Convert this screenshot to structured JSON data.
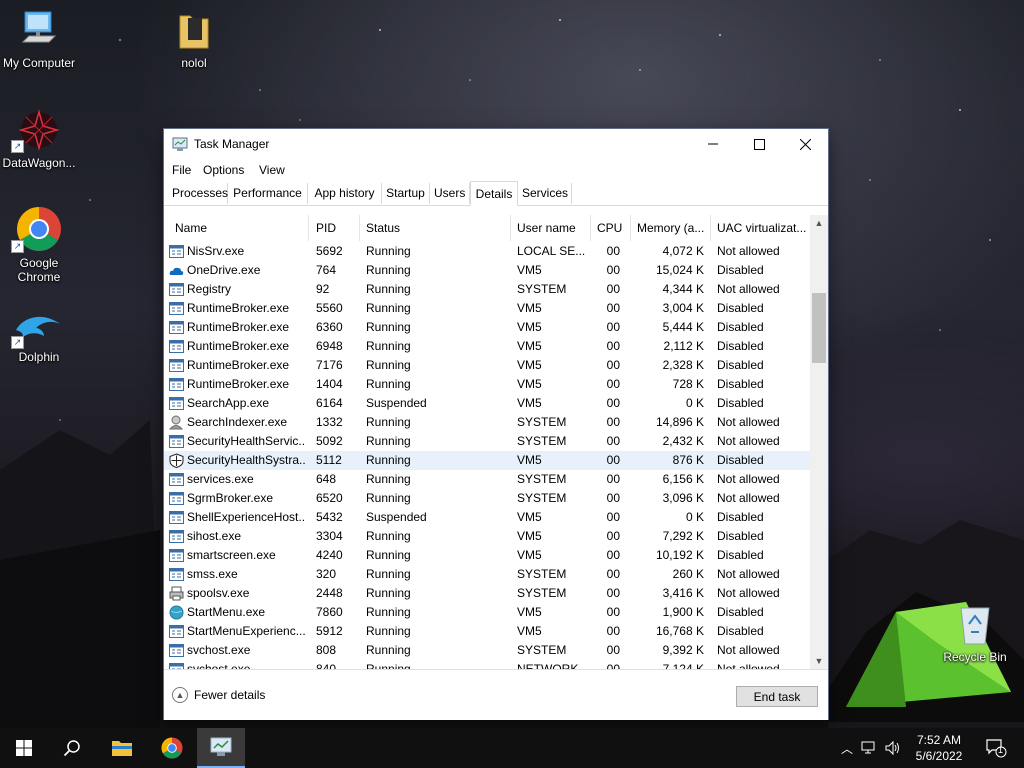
{
  "desktop": {
    "icons": [
      {
        "label": "My Computer"
      },
      {
        "label": "nolol"
      },
      {
        "label": "DataWagon..."
      },
      {
        "label": "Google Chrome"
      },
      {
        "label": "Dolphin"
      },
      {
        "label": "Recycle Bin"
      }
    ]
  },
  "window": {
    "title": "Task Manager",
    "menu": [
      "File",
      "Options",
      "View"
    ],
    "tabs": [
      "Processes",
      "Performance",
      "App history",
      "Startup",
      "Users",
      "Details",
      "Services"
    ],
    "active_tab": "Details",
    "columns": [
      "Name",
      "PID",
      "Status",
      "User name",
      "CPU",
      "Memory (a...",
      "UAC virtualizat..."
    ],
    "rows": [
      {
        "name": "NisSrv.exe",
        "pid": "5692",
        "status": "Running",
        "user": "LOCAL SE...",
        "cpu": "00",
        "mem": "4,072 K",
        "uac": "Not allowed",
        "icon": "exe-icon"
      },
      {
        "name": "OneDrive.exe",
        "pid": "764",
        "status": "Running",
        "user": "VM5",
        "cpu": "00",
        "mem": "15,024 K",
        "uac": "Disabled",
        "icon": "onedrive-icon"
      },
      {
        "name": "Registry",
        "pid": "92",
        "status": "Running",
        "user": "SYSTEM",
        "cpu": "00",
        "mem": "4,344 K",
        "uac": "Not allowed",
        "icon": "exe-icon"
      },
      {
        "name": "RuntimeBroker.exe",
        "pid": "5560",
        "status": "Running",
        "user": "VM5",
        "cpu": "00",
        "mem": "3,004 K",
        "uac": "Disabled",
        "icon": "exe-icon"
      },
      {
        "name": "RuntimeBroker.exe",
        "pid": "6360",
        "status": "Running",
        "user": "VM5",
        "cpu": "00",
        "mem": "5,444 K",
        "uac": "Disabled",
        "icon": "exe-icon"
      },
      {
        "name": "RuntimeBroker.exe",
        "pid": "6948",
        "status": "Running",
        "user": "VM5",
        "cpu": "00",
        "mem": "2,112 K",
        "uac": "Disabled",
        "icon": "exe-icon"
      },
      {
        "name": "RuntimeBroker.exe",
        "pid": "7176",
        "status": "Running",
        "user": "VM5",
        "cpu": "00",
        "mem": "2,328 K",
        "uac": "Disabled",
        "icon": "exe-icon"
      },
      {
        "name": "RuntimeBroker.exe",
        "pid": "1404",
        "status": "Running",
        "user": "VM5",
        "cpu": "00",
        "mem": "728 K",
        "uac": "Disabled",
        "icon": "exe-icon"
      },
      {
        "name": "SearchApp.exe",
        "pid": "6164",
        "status": "Suspended",
        "user": "VM5",
        "cpu": "00",
        "mem": "0 K",
        "uac": "Disabled",
        "icon": "exe-icon"
      },
      {
        "name": "SearchIndexer.exe",
        "pid": "1332",
        "status": "Running",
        "user": "SYSTEM",
        "cpu": "00",
        "mem": "14,896 K",
        "uac": "Not allowed",
        "icon": "search-indexer-icon"
      },
      {
        "name": "SecurityHealthServic...",
        "pid": "5092",
        "status": "Running",
        "user": "SYSTEM",
        "cpu": "00",
        "mem": "2,432 K",
        "uac": "Not allowed",
        "icon": "exe-icon"
      },
      {
        "name": "SecurityHealthSystra...",
        "pid": "5112",
        "status": "Running",
        "user": "VM5",
        "cpu": "00",
        "mem": "876 K",
        "uac": "Disabled",
        "icon": "shield-icon"
      },
      {
        "name": "services.exe",
        "pid": "648",
        "status": "Running",
        "user": "SYSTEM",
        "cpu": "00",
        "mem": "6,156 K",
        "uac": "Not allowed",
        "icon": "exe-icon"
      },
      {
        "name": "SgrmBroker.exe",
        "pid": "6520",
        "status": "Running",
        "user": "SYSTEM",
        "cpu": "00",
        "mem": "3,096 K",
        "uac": "Not allowed",
        "icon": "exe-icon"
      },
      {
        "name": "ShellExperienceHost....",
        "pid": "5432",
        "status": "Suspended",
        "user": "VM5",
        "cpu": "00",
        "mem": "0 K",
        "uac": "Disabled",
        "icon": "exe-icon"
      },
      {
        "name": "sihost.exe",
        "pid": "3304",
        "status": "Running",
        "user": "VM5",
        "cpu": "00",
        "mem": "7,292 K",
        "uac": "Disabled",
        "icon": "exe-icon"
      },
      {
        "name": "smartscreen.exe",
        "pid": "4240",
        "status": "Running",
        "user": "VM5",
        "cpu": "00",
        "mem": "10,192 K",
        "uac": "Disabled",
        "icon": "exe-icon"
      },
      {
        "name": "smss.exe",
        "pid": "320",
        "status": "Running",
        "user": "SYSTEM",
        "cpu": "00",
        "mem": "260 K",
        "uac": "Not allowed",
        "icon": "exe-icon"
      },
      {
        "name": "spoolsv.exe",
        "pid": "2448",
        "status": "Running",
        "user": "SYSTEM",
        "cpu": "00",
        "mem": "3,416 K",
        "uac": "Not allowed",
        "icon": "printer-icon"
      },
      {
        "name": "StartMenu.exe",
        "pid": "7860",
        "status": "Running",
        "user": "VM5",
        "cpu": "00",
        "mem": "1,900 K",
        "uac": "Disabled",
        "icon": "globe-icon"
      },
      {
        "name": "StartMenuExperienc...",
        "pid": "5912",
        "status": "Running",
        "user": "VM5",
        "cpu": "00",
        "mem": "16,768 K",
        "uac": "Disabled",
        "icon": "exe-icon"
      },
      {
        "name": "svchost.exe",
        "pid": "808",
        "status": "Running",
        "user": "SYSTEM",
        "cpu": "00",
        "mem": "9,392 K",
        "uac": "Not allowed",
        "icon": "exe-icon"
      },
      {
        "name": "svchost.exe",
        "pid": "840",
        "status": "Running",
        "user": "NETWORK...",
        "cpu": "00",
        "mem": "7,124 K",
        "uac": "Not allowed",
        "icon": "exe-icon"
      }
    ],
    "selected_row": "SecurityHealthSystra...",
    "footer": {
      "fewer_details": "Fewer details",
      "end_task": "End task"
    }
  },
  "taskbar": {
    "pinned": [
      "windows-start-icon",
      "search-icon",
      "file-explorer-icon",
      "chrome-icon",
      "task-manager-icon"
    ],
    "clock": {
      "time": "7:52 AM",
      "date": "5/6/2022"
    },
    "notification_count": "1"
  }
}
